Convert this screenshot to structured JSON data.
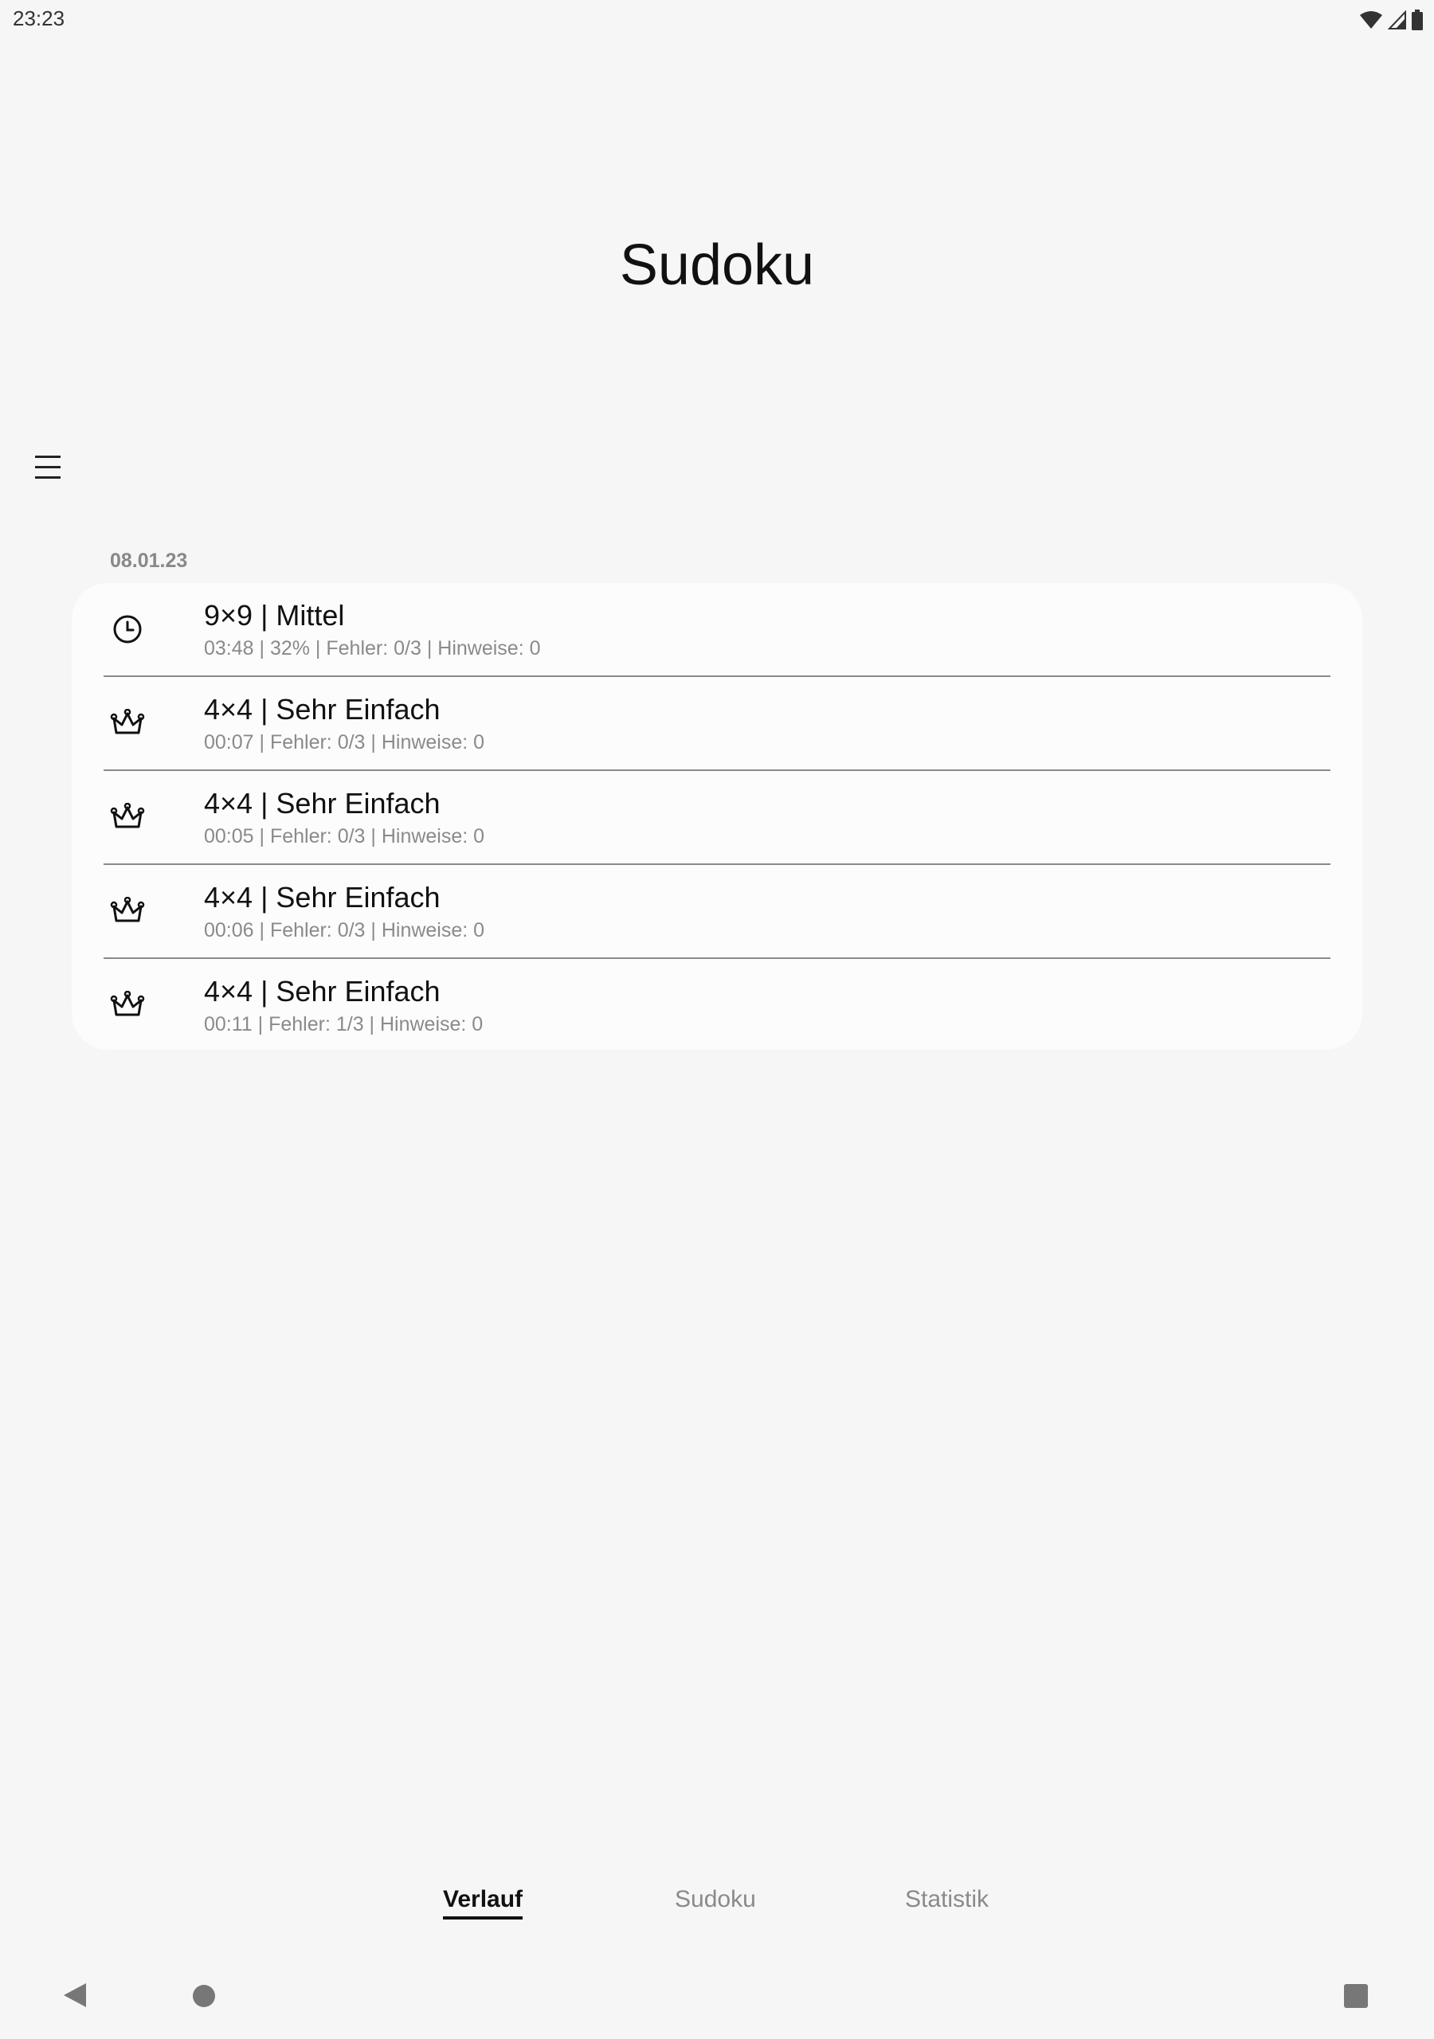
{
  "status_bar": {
    "time": "23:23"
  },
  "app": {
    "title": "Sudoku"
  },
  "history": {
    "date": "08.01.23",
    "items": [
      {
        "icon": "clock-icon",
        "title": "9×9 | Mittel",
        "subtitle": "03:48 | 32% | Fehler: 0/3 | Hinweise: 0"
      },
      {
        "icon": "crown-icon",
        "title": "4×4 | Sehr Einfach",
        "subtitle": "00:07 | Fehler: 0/3 | Hinweise: 0"
      },
      {
        "icon": "crown-icon",
        "title": "4×4 | Sehr Einfach",
        "subtitle": "00:05 | Fehler: 0/3 | Hinweise: 0"
      },
      {
        "icon": "crown-icon",
        "title": "4×4 | Sehr Einfach",
        "subtitle": "00:06 | Fehler: 0/3 | Hinweise: 0"
      },
      {
        "icon": "crown-icon",
        "title": "4×4 | Sehr Einfach",
        "subtitle": "00:11 | Fehler: 1/3 | Hinweise: 0"
      }
    ]
  },
  "tabs": [
    {
      "label": "Verlauf",
      "active": true
    },
    {
      "label": "Sudoku",
      "active": false
    },
    {
      "label": "Statistik",
      "active": false
    }
  ],
  "colors": {
    "background": "#f6f6f6",
    "card": "#fcfcfc",
    "secondary_text": "#8a8a8a"
  }
}
